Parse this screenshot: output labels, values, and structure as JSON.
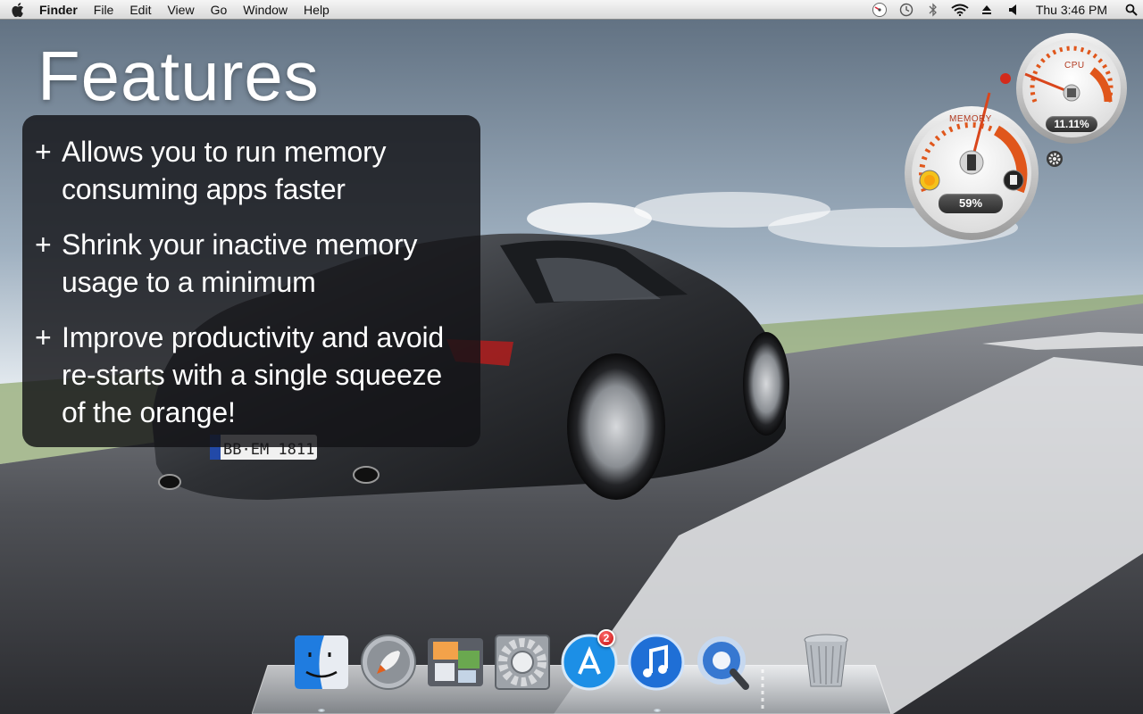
{
  "menubar": {
    "app_name": "Finder",
    "items": [
      "File",
      "Edit",
      "View",
      "Go",
      "Window",
      "Help"
    ],
    "clock": "Thu 3:46 PM",
    "status_icons": [
      "memory-clean-icon",
      "time-machine-icon",
      "bluetooth-icon",
      "wifi-icon",
      "eject-icon",
      "volume-icon",
      "spotlight-icon"
    ]
  },
  "headline": "Features",
  "features": [
    {
      "bullet": "+",
      "text": "Allows you to run memory consuming apps faster"
    },
    {
      "bullet": "+",
      "text": "Shrink your inactive memory usage to a minimum"
    },
    {
      "bullet": "+",
      "text": "Improve productivity and avoid re-starts with a single squeeze of the orange!"
    }
  ],
  "widget": {
    "cpu": {
      "title": "CPU",
      "readout": "11.11%"
    },
    "memory": {
      "title": "MEMORY",
      "readout": "59%"
    }
  },
  "dock": {
    "items": [
      {
        "name": "finder",
        "icon": "finder-icon"
      },
      {
        "name": "launchpad",
        "icon": "rocket-icon"
      },
      {
        "name": "photo-gallery",
        "icon": "photos-icon"
      },
      {
        "name": "system-preferences",
        "icon": "gear-icon"
      },
      {
        "name": "app-store",
        "icon": "app-store-icon",
        "badge": "2"
      },
      {
        "name": "itunes",
        "icon": "music-note-icon"
      },
      {
        "name": "quicktime",
        "icon": "quicktime-icon"
      },
      {
        "name": "trash",
        "icon": "trash-icon"
      }
    ]
  },
  "colors": {
    "panel_bg": "#121216",
    "gauge_accent": "#e0561b",
    "badge_red": "#d11a1a"
  }
}
